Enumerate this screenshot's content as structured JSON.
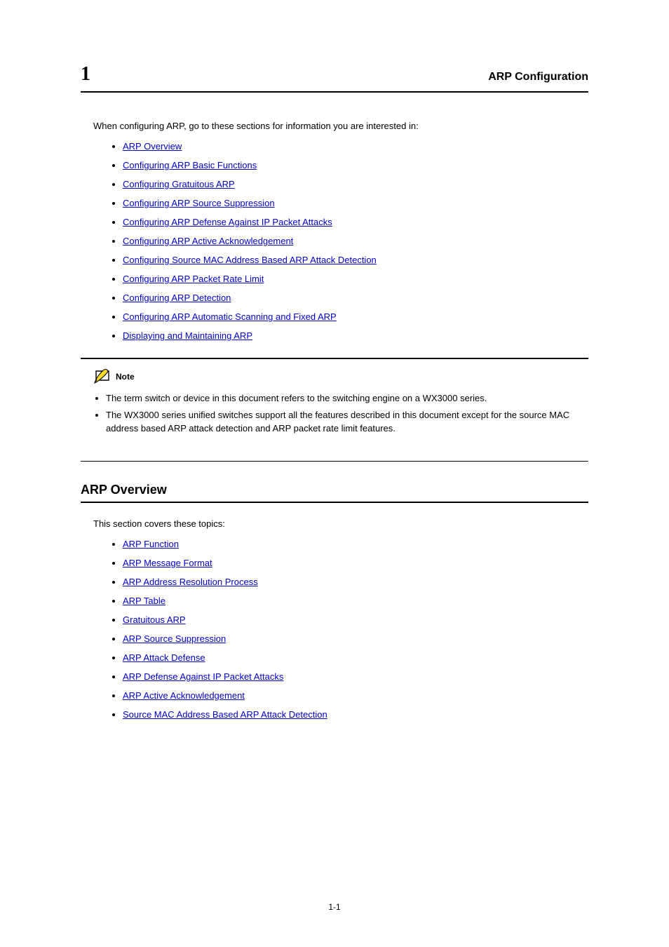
{
  "chapter": {
    "number": "1",
    "title": "ARP Configuration"
  },
  "intro1": "When configuring ARP, go to these sections for information you are interested in:",
  "list1": [
    "ARP Overview",
    "Configuring ARP Basic Functions",
    "Configuring Gratuitous ARP",
    "Configuring ARP Source Suppression",
    "Configuring ARP Defense Against IP Packet Attacks",
    "Configuring ARP Active Acknowledgement",
    "Configuring Source MAC Address Based ARP Attack Detection",
    "Configuring ARP Packet Rate Limit",
    "Configuring ARP Detection",
    "Configuring ARP Automatic Scanning and Fixed ARP",
    "Displaying and Maintaining ARP"
  ],
  "note": {
    "label": "Note",
    "items": [
      "The term switch or device in this document refers to the switching engine on a WX3000 series.",
      "The WX3000 series unified switches support all the features described in this document except for the source MAC address based ARP attack detection and ARP packet rate limit features."
    ]
  },
  "section": {
    "title": "ARP Overview"
  },
  "intro2": "This section covers these topics:",
  "list2": [
    "ARP Function",
    "ARP Message Format",
    "ARP Address Resolution Process",
    "ARP Table",
    "Gratuitous ARP",
    "ARP Source Suppression",
    "ARP Attack Defense",
    "ARP Defense Against IP Packet Attacks",
    "ARP Active Acknowledgement",
    "Source MAC Address Based ARP Attack Detection"
  ],
  "pageNumber": "1-1"
}
